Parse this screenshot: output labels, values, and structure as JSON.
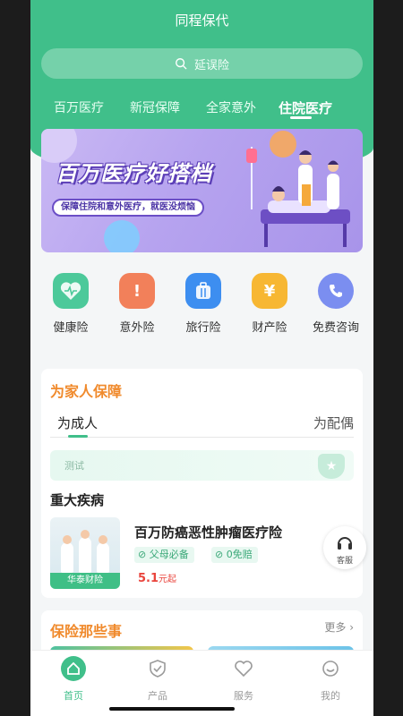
{
  "header": {
    "title": "同程保代",
    "search_placeholder": "延误险",
    "tabs": [
      {
        "label": "百万医疗"
      },
      {
        "label": "新冠保障"
      },
      {
        "label": "全家意外"
      },
      {
        "label": "住院医疗"
      }
    ],
    "active_tab": "住院医疗",
    "brand_color": "#40bf8a"
  },
  "banner": {
    "title": "百万医疗好搭档",
    "subtitle": "保障住院和意外医疗，就医没烦恼"
  },
  "categories": [
    {
      "label": "健康险",
      "icon": "heart-pulse-icon",
      "color": "#4cc99a"
    },
    {
      "label": "意外险",
      "icon": "warning-triangle-icon",
      "color": "#f2805a"
    },
    {
      "label": "旅行险",
      "icon": "suitcase-icon",
      "color": "#3d8ef0"
    },
    {
      "label": "财产险",
      "icon": "money-bag-icon",
      "color": "#f7b733"
    },
    {
      "label": "免费咨询",
      "icon": "phone-icon",
      "color": "#7b8ef0"
    }
  ],
  "family": {
    "title": "为家人保障",
    "segment_left": "为成人",
    "segment_right": "为配偶",
    "test_label": "测试",
    "section": "重大疾病",
    "product": {
      "name": "百万防癌恶性肿瘤医疗险",
      "company": "华泰财险",
      "tags": [
        "父母必备",
        "0免赔"
      ],
      "price": "5.1",
      "price_unit": "元起"
    }
  },
  "customer_service": {
    "label": "客服"
  },
  "news": {
    "title": "保险那些事",
    "more": "更多"
  },
  "nav": {
    "items": [
      {
        "label": "首页",
        "icon": "home-icon",
        "active": true
      },
      {
        "label": "产品",
        "icon": "shield-check-icon",
        "active": false
      },
      {
        "label": "服务",
        "icon": "heart-icon",
        "active": false
      },
      {
        "label": "我的",
        "icon": "smile-face-icon",
        "active": false
      }
    ]
  }
}
